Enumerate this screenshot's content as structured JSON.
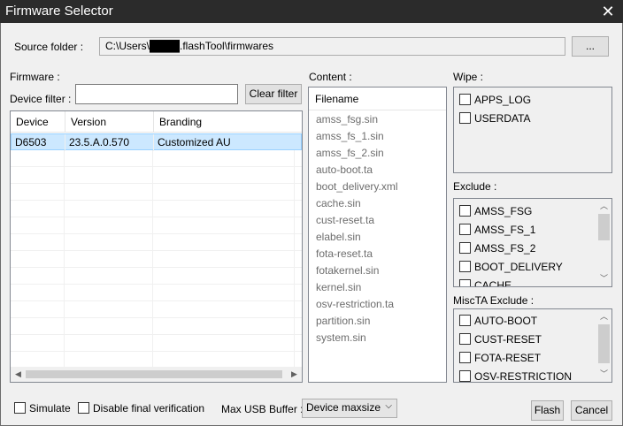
{
  "window": {
    "title": "Firmware Selector",
    "close_glyph": "✕"
  },
  "source": {
    "label": "Source folder :",
    "path": "C:\\Users\\████.flashTool\\firmwares",
    "browse_label": "..."
  },
  "firmware": {
    "label": "Firmware :",
    "filter_label": "Device filter :",
    "filter_value": "",
    "clear_filter_label": "Clear filter",
    "columns": [
      "Device",
      "Version",
      "Branding"
    ],
    "rows": [
      [
        "D6503",
        "23.5.A.0.570",
        "Customized AU"
      ]
    ]
  },
  "content": {
    "label": "Content :",
    "header": "Filename",
    "files": [
      "amss_fsg.sin",
      "amss_fs_1.sin",
      "amss_fs_2.sin",
      "auto-boot.ta",
      "boot_delivery.xml",
      "cache.sin",
      "cust-reset.ta",
      "elabel.sin",
      "fota-reset.ta",
      "fotakernel.sin",
      "kernel.sin",
      "osv-restriction.ta",
      "partition.sin",
      "system.sin"
    ]
  },
  "wipe": {
    "label": "Wipe :",
    "items": [
      "APPS_LOG",
      "USERDATA"
    ]
  },
  "exclude": {
    "label": "Exclude :",
    "items": [
      "AMSS_FSG",
      "AMSS_FS_1",
      "AMSS_FS_2",
      "BOOT_DELIVERY",
      "CACHE"
    ]
  },
  "miscta": {
    "label": "MiscTA Exclude :",
    "items": [
      "AUTO-BOOT",
      "CUST-RESET",
      "FOTA-RESET",
      "OSV-RESTRICTION"
    ]
  },
  "footer": {
    "simulate_label": "Simulate",
    "disable_verif_label": "Disable final verification",
    "usb_buffer_label": "Max USB Buffer :",
    "usb_buffer_value": "Device maxsize",
    "flash_label": "Flash",
    "cancel_label": "Cancel"
  }
}
